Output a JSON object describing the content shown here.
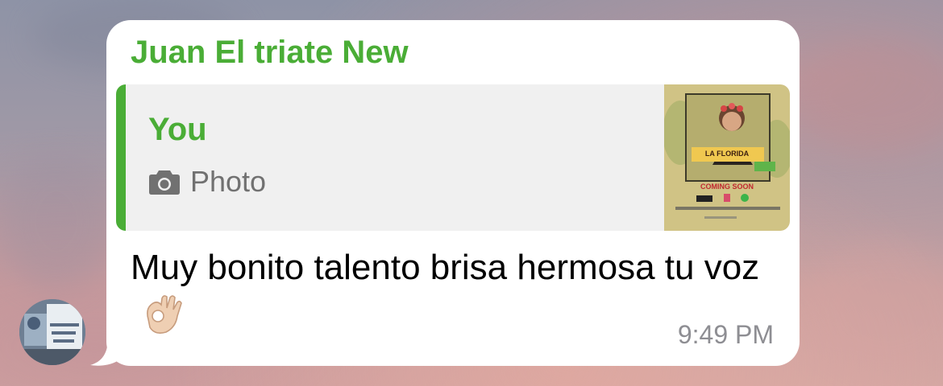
{
  "message": {
    "sender": "Juan El triate New",
    "reply": {
      "author": "You",
      "type_label": "Photo",
      "type_icon": "camera-icon",
      "thumbnail": {
        "lines": [
          "LA FLORIDA",
          "COMING SOON"
        ]
      }
    },
    "text": "Muy bonito talento brisa hermosa tu voz",
    "emoji": "ok-hand-emoji",
    "time": "9:49 PM"
  },
  "colors": {
    "sender_name": "#4aad36",
    "reply_bar": "#4aad36",
    "bubble": "#ffffff",
    "timestamp": "#8e8e93"
  }
}
